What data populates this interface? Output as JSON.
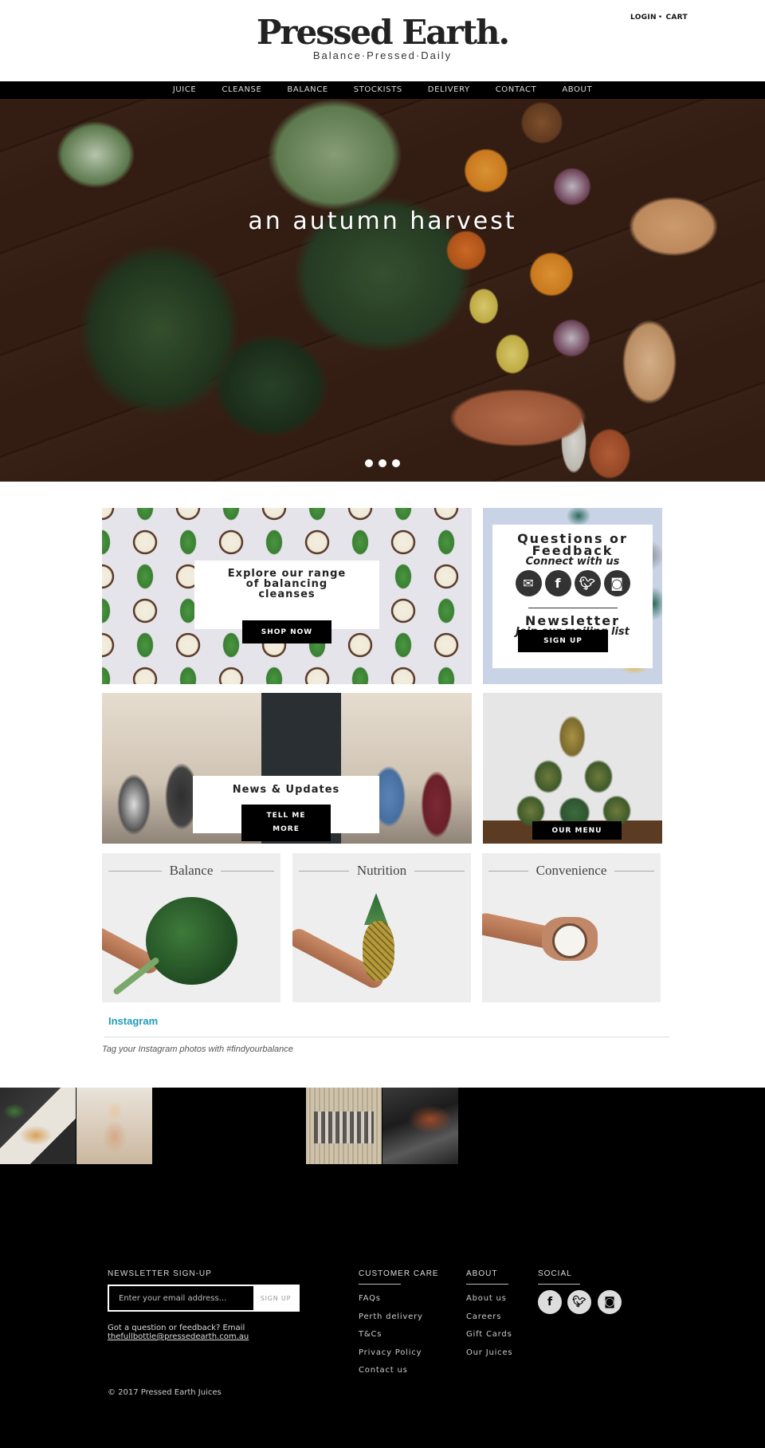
{
  "header": {
    "logo_title": "Pressed Earth.",
    "logo_tagline": "Balance·Pressed·Daily",
    "login_label": "LOGIN",
    "separator": "•",
    "cart_label": "CART"
  },
  "nav": {
    "items": [
      {
        "label": "JUICE"
      },
      {
        "label": "CLEANSE"
      },
      {
        "label": "BALANCE"
      },
      {
        "label": "STOCKISTS"
      },
      {
        "label": "DELIVERY"
      },
      {
        "label": "CONTACT"
      },
      {
        "label": "ABOUT"
      }
    ]
  },
  "hero": {
    "title": "an autumn harvest",
    "slide_count": 3,
    "active_slide": 1
  },
  "tiles": {
    "cleanse": {
      "heading": "Explore our range of balancing cleanses",
      "button": "SHOP NOW"
    },
    "questions": {
      "title": "Questions or Feedback",
      "subtitle": "Connect with us",
      "icons": [
        "email-icon",
        "facebook-icon",
        "twitter-icon",
        "instagram-icon"
      ],
      "newsletter_title": "Newsletter",
      "newsletter_subtitle": "Join our mailing list",
      "button": "SIGN UP"
    },
    "news": {
      "heading": "News & Updates",
      "button_line1": "TELL ME",
      "button_line2": "MORE"
    },
    "menu": {
      "button": "OUR MENU"
    }
  },
  "features": [
    {
      "title": "Balance"
    },
    {
      "title": "Nutrition"
    },
    {
      "title": "Convenience"
    }
  ],
  "instagram": {
    "title": "Instagram",
    "tagline": "Tag your Instagram photos with #findyourbalance"
  },
  "footer": {
    "newsletter_heading": "NEWSLETTER SIGN-UP",
    "email_placeholder": "Enter your email address...",
    "signup_button": "SIGN UP",
    "question_text": "Got a question or feedback? Email",
    "email": "thefullbottle@pressedearth.com.au",
    "customer_care": {
      "heading": "CUSTOMER CARE",
      "links": [
        "FAQs",
        "Perth delivery",
        "T&Cs",
        "Privacy Policy",
        "Contact us"
      ]
    },
    "about": {
      "heading": "ABOUT",
      "links": [
        "About us",
        "Careers",
        "Gift Cards",
        "Our Juices"
      ]
    },
    "social": {
      "heading": "SOCIAL",
      "icons": [
        "facebook-icon",
        "twitter-icon",
        "instagram-icon"
      ]
    },
    "copyright": "© 2017 Pressed Earth Juices"
  },
  "colors": {
    "nav_bg": "#000000",
    "accent_instagram": "#1f9bbd",
    "feature_bg": "#eeeeee",
    "button_bg": "#000000"
  }
}
